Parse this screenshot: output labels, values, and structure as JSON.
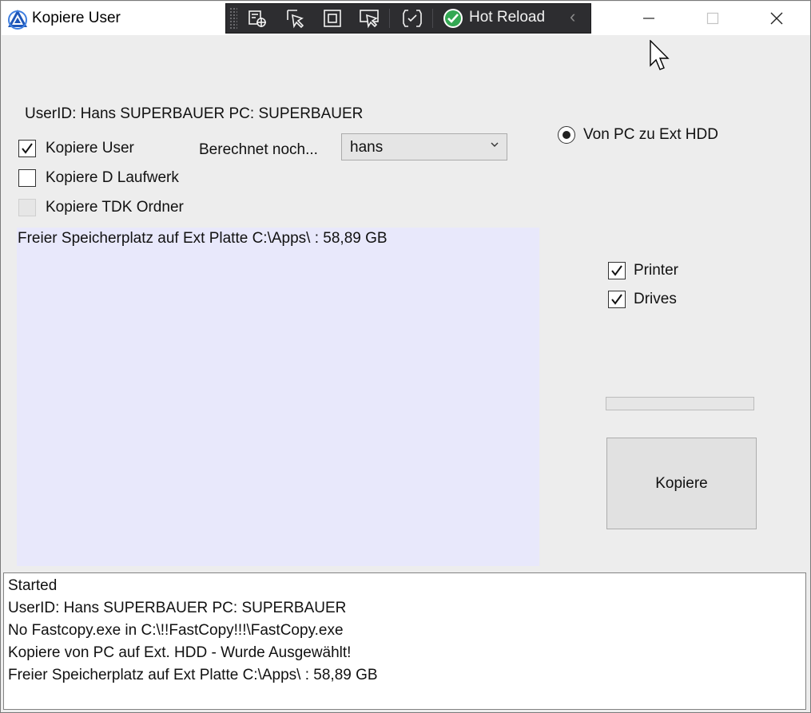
{
  "window": {
    "title": "Kopiere User",
    "controls": [
      "minimize-icon",
      "maximize-icon",
      "close-icon"
    ]
  },
  "debug_toolbar": {
    "icons": [
      "live-visual-tree-icon",
      "select-element-icon",
      "display-adorners-icon",
      "track-focus-icon",
      "xaml-binding-failures-icon"
    ],
    "hot_reload_label": "Hot Reload",
    "hot_reload_status_color": "#34a853",
    "collapse_icon": "chevron-left-icon"
  },
  "form": {
    "user_info": "UserID: Hans  SUPERBAUER  PC: SUPERBAUER",
    "checkboxes": [
      {
        "label": "Kopiere User",
        "checked": true,
        "enabled": true
      },
      {
        "label": "Kopiere D Laufwerk",
        "checked": false,
        "enabled": true
      },
      {
        "label": "Kopiere TDK Ordner",
        "checked": false,
        "enabled": false
      }
    ],
    "calc_label": "Berechnet noch...",
    "user_select": {
      "value": "hans"
    },
    "info_text": "Freier Speicherplatz auf Ext Platte C:\\Apps\\ : 58,89 GB",
    "info_background": "#e8e8fb",
    "direction_radio": {
      "label": "Von PC zu Ext HDD",
      "selected": true
    },
    "options": [
      {
        "label": "Printer",
        "checked": true
      },
      {
        "label": "Drives",
        "checked": true
      }
    ],
    "progress": {
      "value": 0
    },
    "copy_button_label": "Kopiere"
  },
  "log": {
    "lines": [
      "Started",
      "UserID: Hans  SUPERBAUER  PC: SUPERBAUER",
      "No Fastcopy.exe in C:\\!!FastCopy!!!\\FastCopy.exe",
      "Kopiere von PC auf Ext. HDD - Wurde Ausgewählt!",
      "Freier Speicherplatz auf Ext Platte C:\\Apps\\ : 58,89 GB"
    ]
  }
}
